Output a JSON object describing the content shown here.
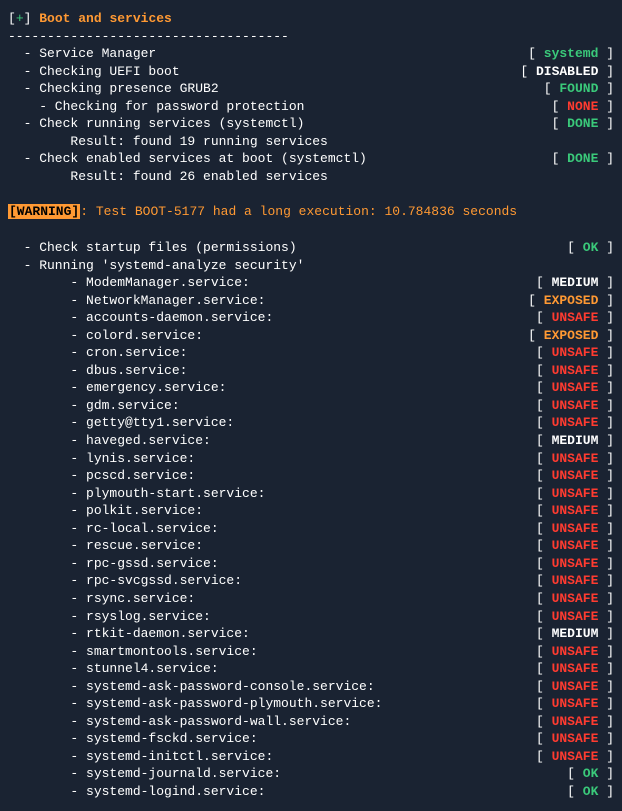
{
  "header": {
    "prefix_open": "[",
    "plus": "+",
    "prefix_close": "] ",
    "title": "Boot and services"
  },
  "divider": "------------------------------------",
  "top_items": [
    {
      "label": "  - Service Manager",
      "status": "systemd",
      "class": "s-systemd"
    },
    {
      "label": "  - Checking UEFI boot",
      "status": "DISABLED",
      "class": "s-disabled"
    },
    {
      "label": "  - Checking presence GRUB2",
      "status": "FOUND",
      "class": "s-found"
    },
    {
      "label": "    - Checking for password protection",
      "status": "NONE",
      "class": "s-none"
    },
    {
      "label": "  - Check running services (systemctl)",
      "status": "DONE",
      "class": "s-done"
    }
  ],
  "result1": "        Result: found 19 running services",
  "top_items2": [
    {
      "label": "  - Check enabled services at boot (systemctl)",
      "status": "DONE",
      "class": "s-done"
    }
  ],
  "result2": "        Result: found 26 enabled services",
  "warning": {
    "badge": "[WARNING]",
    "colon": ":",
    "text": " Test BOOT-5177 had a long execution: 10.784836 seconds"
  },
  "mid_items": [
    {
      "label": "  - Check startup files (permissions)",
      "status": "OK",
      "class": "s-ok"
    }
  ],
  "running_line": "  - Running 'systemd-analyze security'",
  "services": [
    {
      "name": "ModemManager.service:",
      "status": "MEDIUM",
      "class": "s-medium"
    },
    {
      "name": "NetworkManager.service:",
      "status": "EXPOSED",
      "class": "s-exposed"
    },
    {
      "name": "accounts-daemon.service:",
      "status": "UNSAFE",
      "class": "s-unsafe"
    },
    {
      "name": "colord.service:",
      "status": "EXPOSED",
      "class": "s-exposed"
    },
    {
      "name": "cron.service:",
      "status": "UNSAFE",
      "class": "s-unsafe"
    },
    {
      "name": "dbus.service:",
      "status": "UNSAFE",
      "class": "s-unsafe"
    },
    {
      "name": "emergency.service:",
      "status": "UNSAFE",
      "class": "s-unsafe"
    },
    {
      "name": "gdm.service:",
      "status": "UNSAFE",
      "class": "s-unsafe"
    },
    {
      "name": "getty@tty1.service:",
      "status": "UNSAFE",
      "class": "s-unsafe"
    },
    {
      "name": "haveged.service:",
      "status": "MEDIUM",
      "class": "s-medium"
    },
    {
      "name": "lynis.service:",
      "status": "UNSAFE",
      "class": "s-unsafe"
    },
    {
      "name": "pcscd.service:",
      "status": "UNSAFE",
      "class": "s-unsafe"
    },
    {
      "name": "plymouth-start.service:",
      "status": "UNSAFE",
      "class": "s-unsafe"
    },
    {
      "name": "polkit.service:",
      "status": "UNSAFE",
      "class": "s-unsafe"
    },
    {
      "name": "rc-local.service:",
      "status": "UNSAFE",
      "class": "s-unsafe"
    },
    {
      "name": "rescue.service:",
      "status": "UNSAFE",
      "class": "s-unsafe"
    },
    {
      "name": "rpc-gssd.service:",
      "status": "UNSAFE",
      "class": "s-unsafe"
    },
    {
      "name": "rpc-svcgssd.service:",
      "status": "UNSAFE",
      "class": "s-unsafe"
    },
    {
      "name": "rsync.service:",
      "status": "UNSAFE",
      "class": "s-unsafe"
    },
    {
      "name": "rsyslog.service:",
      "status": "UNSAFE",
      "class": "s-unsafe"
    },
    {
      "name": "rtkit-daemon.service:",
      "status": "MEDIUM",
      "class": "s-medium"
    },
    {
      "name": "smartmontools.service:",
      "status": "UNSAFE",
      "class": "s-unsafe"
    },
    {
      "name": "stunnel4.service:",
      "status": "UNSAFE",
      "class": "s-unsafe"
    },
    {
      "name": "systemd-ask-password-console.service:",
      "status": "UNSAFE",
      "class": "s-unsafe"
    },
    {
      "name": "systemd-ask-password-plymouth.service:",
      "status": "UNSAFE",
      "class": "s-unsafe"
    },
    {
      "name": "systemd-ask-password-wall.service:",
      "status": "UNSAFE",
      "class": "s-unsafe"
    },
    {
      "name": "systemd-fsckd.service:",
      "status": "UNSAFE",
      "class": "s-unsafe"
    },
    {
      "name": "systemd-initctl.service:",
      "status": "UNSAFE",
      "class": "s-unsafe"
    },
    {
      "name": "systemd-journald.service:",
      "status": "OK",
      "class": "s-ok"
    },
    {
      "name": "systemd-logind.service:",
      "status": "OK",
      "class": "s-ok"
    }
  ],
  "brackets": {
    "open": "[ ",
    "close": " ]"
  },
  "service_prefix": "        - "
}
